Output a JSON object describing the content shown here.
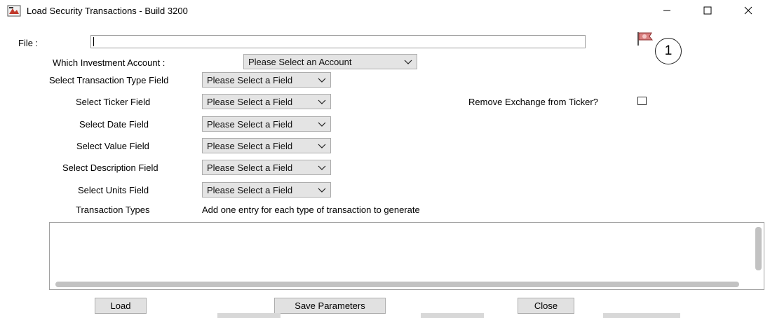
{
  "window": {
    "title": "Load Security Transactions - Build 3200"
  },
  "file": {
    "label": "File :",
    "value": ""
  },
  "callout": {
    "number": "1"
  },
  "account": {
    "label": "Which Investment Account :",
    "selected": "Please Select an Account"
  },
  "fields": {
    "transaction_type": {
      "label": "Select Transaction Type Field",
      "selected": "Please Select a Field"
    },
    "ticker": {
      "label": "Select Ticker Field",
      "selected": "Please Select a Field"
    },
    "date": {
      "label": "Select Date Field",
      "selected": "Please Select a Field"
    },
    "value": {
      "label": "Select Value Field",
      "selected": "Please Select a Field"
    },
    "description": {
      "label": "Select Description Field",
      "selected": "Please Select a Field"
    },
    "units": {
      "label": "Select Units Field",
      "selected": "Please Select a Field"
    }
  },
  "remove_exchange": {
    "label": "Remove Exchange from Ticker?",
    "checked": false
  },
  "transaction_types": {
    "label": "Transaction Types",
    "hint": "Add one entry for each type of transaction to generate"
  },
  "buttons": {
    "load": "Load",
    "save": "Save Parameters",
    "close": "Close"
  },
  "colors": {
    "combo_bg": "#e4e4e4",
    "button_bg": "#e1e1e1",
    "flag_red": "#c0392b"
  }
}
